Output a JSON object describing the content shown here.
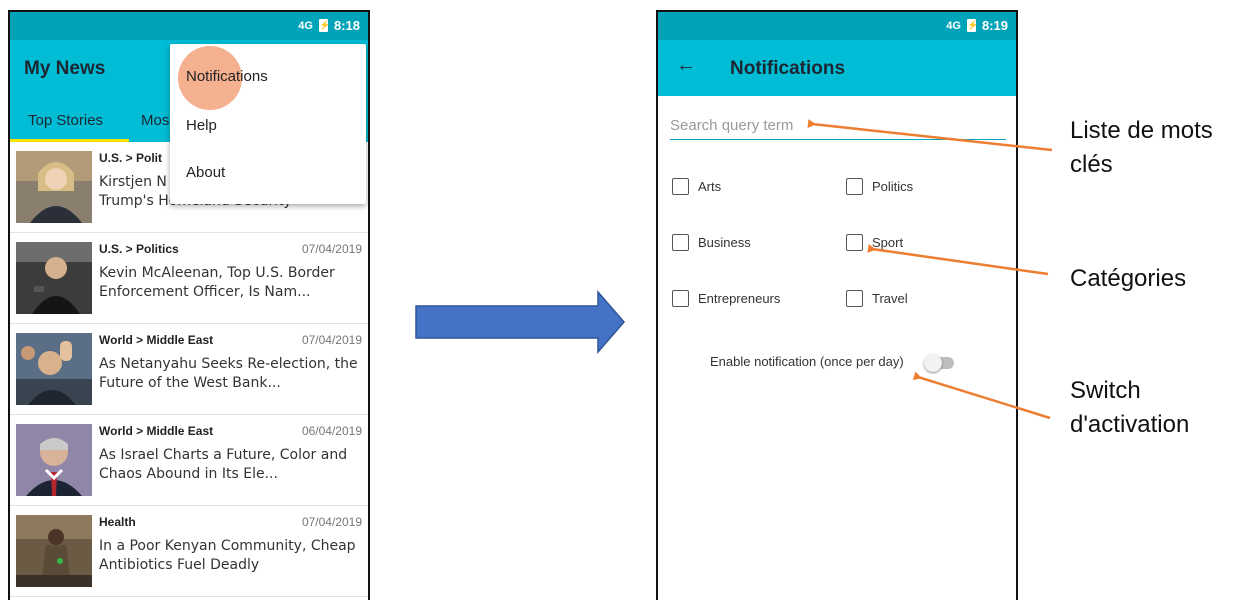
{
  "left_phone": {
    "status": {
      "network": "4G",
      "battery_glyph": "⚡",
      "time": "8:18"
    },
    "app_title": "My News",
    "tabs": [
      {
        "label": "Top Stories"
      },
      {
        "label": "Mos"
      }
    ],
    "menu": {
      "items": [
        {
          "label": "Notifications"
        },
        {
          "label": "Help"
        },
        {
          "label": "About"
        }
      ]
    },
    "articles": [
      {
        "category": "U.S. > Polit",
        "date": "",
        "title": "Kirstjen N\nTrump's Homeland Security"
      },
      {
        "category": "U.S. > Politics",
        "date": "07/04/2019",
        "title": "Kevin McAleenan, Top U.S. Border Enforcement Officer, Is Nam..."
      },
      {
        "category": "World > Middle East",
        "date": "07/04/2019",
        "title": "As Netanyahu Seeks Re-election, the Future of the West Bank..."
      },
      {
        "category": "World > Middle East",
        "date": "06/04/2019",
        "title": "As Israel Charts a Future, Color and Chaos Abound in Its Ele..."
      },
      {
        "category": "Health",
        "date": "07/04/2019",
        "title": "In a Poor Kenyan Community, Cheap Antibiotics Fuel Deadly"
      }
    ]
  },
  "right_phone": {
    "status": {
      "network": "4G",
      "battery_glyph": "⚡",
      "time": "8:19"
    },
    "back_glyph": "←",
    "title": "Notifications",
    "search": {
      "placeholder": "Search query term"
    },
    "categories": [
      {
        "label": "Arts",
        "checked": false
      },
      {
        "label": "Politics",
        "checked": false
      },
      {
        "label": "Business",
        "checked": false
      },
      {
        "label": "Sport",
        "checked": false
      },
      {
        "label": "Entrepreneurs",
        "checked": false
      },
      {
        "label": "Travel",
        "checked": false
      }
    ],
    "switch_label": "Enable notification (once per day)",
    "switch_on": false
  },
  "callouts": {
    "keywords": "Liste de mots\nclés",
    "categories": "Catégories",
    "switch": "Switch\nd'activation"
  },
  "colors": {
    "status_bar": "#00a3b8",
    "app_bar": "#00bcd4",
    "tab_indicator": "#f5e400",
    "transition_arrow": "#4472c4",
    "annotation_arrow": "#ed7d31",
    "touch_indicator": "#f29669"
  }
}
